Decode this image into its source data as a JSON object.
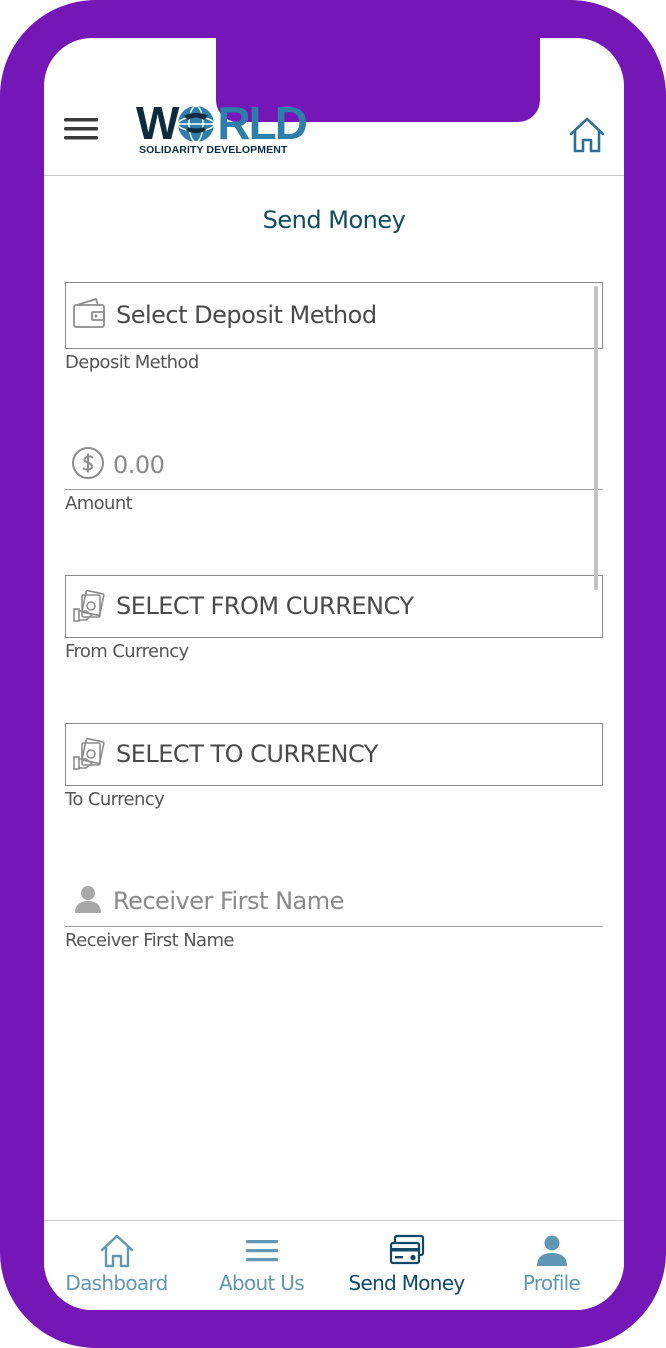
{
  "header": {
    "logo_word": "W",
    "logo_word_rest": "RLD",
    "logo_subtitle": "SOLIDARITY DEVELOPMENT"
  },
  "page": {
    "title": "Send Money"
  },
  "form": {
    "deposit_method": {
      "value": "Select Deposit Method",
      "label": "Deposit Method"
    },
    "amount": {
      "placeholder": "0.00",
      "label": "Amount"
    },
    "from_currency": {
      "value": "SELECT FROM CURRENCY",
      "label": "From Currency"
    },
    "to_currency": {
      "value": "SELECT TO CURRENCY",
      "label": "To Currency"
    },
    "receiver_first_name": {
      "placeholder": "Receiver First Name",
      "label": "Receiver First Name"
    }
  },
  "bottom_nav": {
    "items": [
      {
        "label": "Dashboard",
        "icon": "home-icon",
        "active": false
      },
      {
        "label": "About Us",
        "icon": "menu-lines-icon",
        "active": false
      },
      {
        "label": "Send Money",
        "icon": "cards-icon",
        "active": true
      },
      {
        "label": "Profile",
        "icon": "user-icon",
        "active": false
      }
    ]
  },
  "colors": {
    "frame": "#7417b6",
    "title": "#0f4d63",
    "nav_inactive": "#5f97b5",
    "nav_active": "#0d4a6a"
  }
}
